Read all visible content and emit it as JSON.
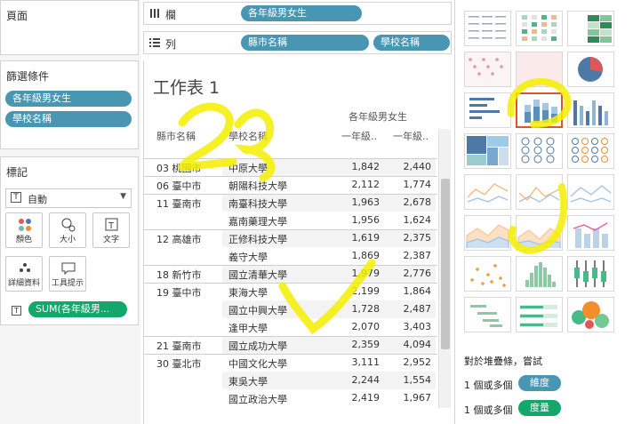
{
  "panels": {
    "pages_title": "頁面",
    "filters_title": "篩選條件",
    "filters": [
      "各年級男女生",
      "學校名稱"
    ],
    "marks_title": "標記",
    "mark_type": "自動",
    "mark_buttons": [
      "顏色",
      "大小",
      "文字",
      "詳細資料",
      "工具提示"
    ],
    "text_pill": "SUM(各年級男..."
  },
  "shelves": {
    "columns_label": "欄",
    "columns_pills": [
      "各年級男女生"
    ],
    "rows_label": "列",
    "rows_pills": [
      "縣市名稱",
      "學校名稱"
    ]
  },
  "view": {
    "sheet_title": "工作表 1",
    "measure_header": "各年級男女生",
    "col_headers": [
      "縣市名稱",
      "學校名稱",
      "一年級..",
      "一年級.."
    ],
    "rows": [
      {
        "city": "",
        "school": "",
        "v1": "",
        "v2": ""
      },
      {
        "city": "03 桃園市",
        "school": "中原大學",
        "v1": "1,842",
        "v2": "2,440"
      },
      {
        "city": "06 臺中市",
        "school": "朝陽科技大學",
        "v1": "2,112",
        "v2": "1,774"
      },
      {
        "city": "11 臺南市",
        "school": "南臺科技大學",
        "v1": "1,963",
        "v2": "2,678"
      },
      {
        "city": "",
        "school": "嘉南藥理大學",
        "v1": "1,956",
        "v2": "1,624"
      },
      {
        "city": "12 高雄市",
        "school": "正修科技大學",
        "v1": "1,619",
        "v2": "2,375"
      },
      {
        "city": "",
        "school": "義守大學",
        "v1": "1,869",
        "v2": "2,387"
      },
      {
        "city": "18 新竹市",
        "school": "國立清華大學",
        "v1": "1,979",
        "v2": "2,776"
      },
      {
        "city": "19 臺中市",
        "school": "東海大學",
        "v1": "2,199",
        "v2": "1,864"
      },
      {
        "city": "",
        "school": "國立中興大學",
        "v1": "1,728",
        "v2": "2,487"
      },
      {
        "city": "",
        "school": "逢甲大學",
        "v1": "2,070",
        "v2": "3,403"
      },
      {
        "city": "21 臺南市",
        "school": "國立成功大學",
        "v1": "2,359",
        "v2": "4,094"
      },
      {
        "city": "30 臺北市",
        "school": "中國文化大學",
        "v1": "3,111",
        "v2": "2,952"
      },
      {
        "city": "",
        "school": "東吳大學",
        "v1": "2,244",
        "v2": "1,554"
      },
      {
        "city": "",
        "school": "國立政治大學",
        "v1": "2,419",
        "v2": "1,967"
      }
    ]
  },
  "showme": {
    "hint_title": "對於堆疊條，嘗試",
    "hint_dim_prefix": "1 個或多個",
    "hint_dim_pill": "維度",
    "hint_meas_prefix": "1 個或多個",
    "hint_meas_pill": "度量",
    "colors": {
      "dimension": "#4996b2",
      "measure": "#13a76b",
      "selected": "#d9582b"
    }
  }
}
